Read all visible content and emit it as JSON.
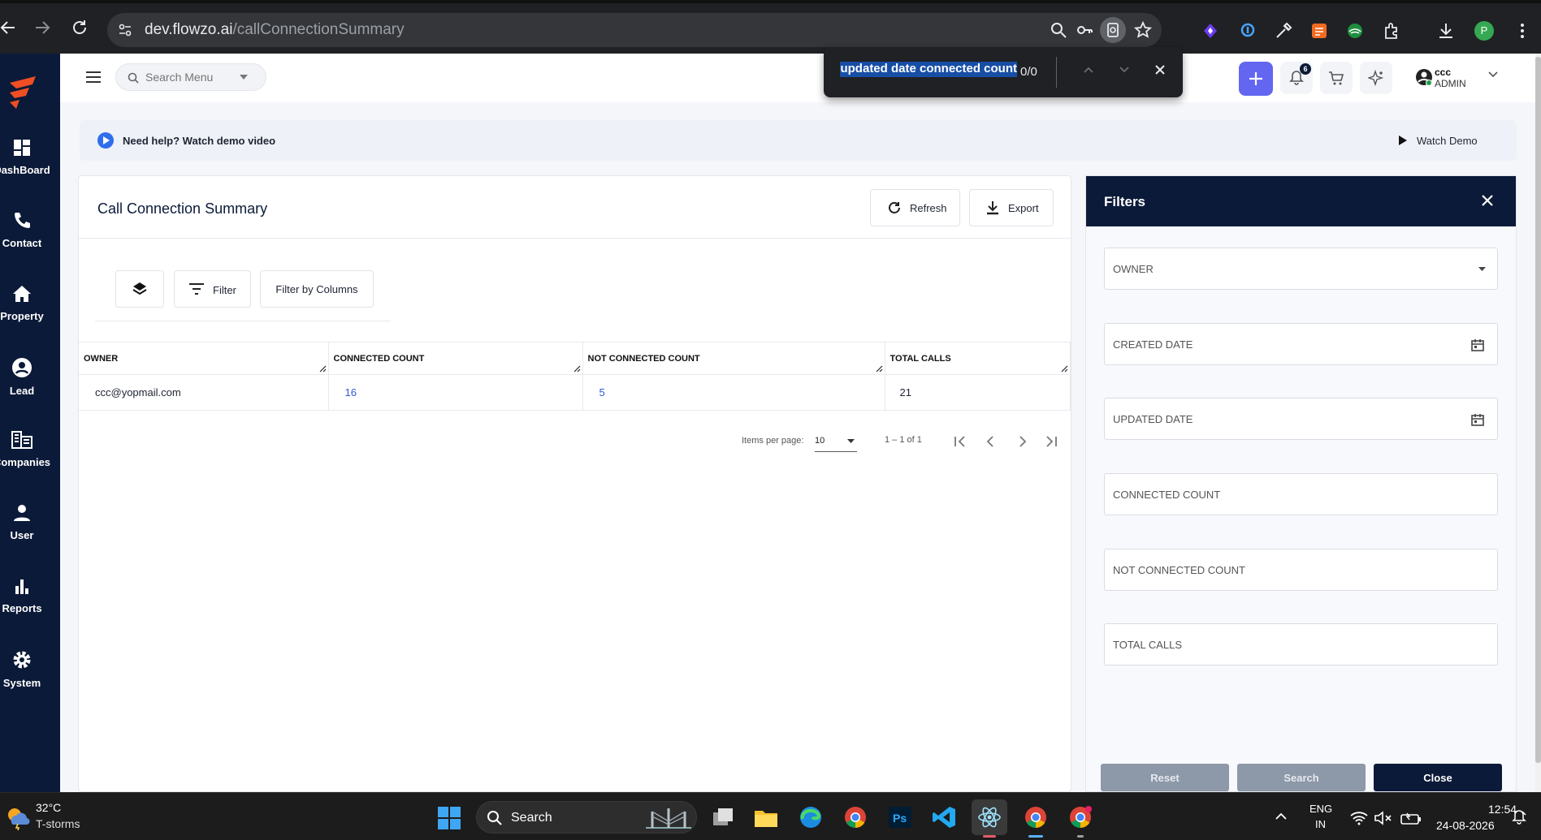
{
  "browser": {
    "url_host": "dev.flowzo.ai",
    "url_path": "/callConnectionSummary",
    "profile_initial": "P"
  },
  "find_bar": {
    "query": "updated date connected count",
    "count": "0/0"
  },
  "sidebar": {
    "items": [
      {
        "label": "DashBoard",
        "icon": "dashboard-icon"
      },
      {
        "label": "Contact",
        "icon": "phone-icon"
      },
      {
        "label": "Property",
        "icon": "home-icon"
      },
      {
        "label": "Lead",
        "icon": "user-circle-icon"
      },
      {
        "label": "Companies",
        "icon": "building-icon"
      },
      {
        "label": "User",
        "icon": "person-icon"
      },
      {
        "label": "Reports",
        "icon": "bar-chart-icon"
      },
      {
        "label": "System",
        "icon": "gear-icon"
      }
    ]
  },
  "header": {
    "search_placeholder": "Search Menu",
    "notification_count": "6",
    "user_name": "ccc",
    "user_role": "ADMIN"
  },
  "help_banner": {
    "text": "Need help? Watch demo video",
    "watch_demo": "Watch Demo"
  },
  "main": {
    "title": "Call Connection Summary",
    "refresh_label": "Refresh",
    "export_label": "Export",
    "filter_label": "Filter",
    "filter_columns_label": "Filter by Columns",
    "table": {
      "columns": [
        "OWNER",
        "CONNECTED COUNT",
        "NOT CONNECTED COUNT",
        "TOTAL CALLS"
      ],
      "rows": [
        [
          "ccc@yopmail.com",
          "16",
          "5",
          "21"
        ]
      ]
    },
    "pagination": {
      "items_per_page_label": "Items per page:",
      "items_per_page": "10",
      "range": "1 – 1 of 1"
    }
  },
  "filters": {
    "title": "Filters",
    "fields": [
      "OWNER",
      "CREATED DATE",
      "UPDATED DATE",
      "CONNECTED COUNT",
      "NOT CONNECTED COUNT",
      "TOTAL CALLS"
    ],
    "reset_label": "Reset",
    "search_label": "Search",
    "close_label": "Close"
  },
  "taskbar": {
    "weather_temp": "32°C",
    "weather_desc": "T-storms",
    "search_label": "Search",
    "lang_code": "ENG",
    "lang_region": "IN",
    "time": "12:54",
    "date": "24-08-2026"
  },
  "colors": {
    "sidebar_bg": "#0b1a38",
    "accent": "#6366f1",
    "link": "#2f5bd3",
    "disabled_button": "#8d98a8"
  }
}
